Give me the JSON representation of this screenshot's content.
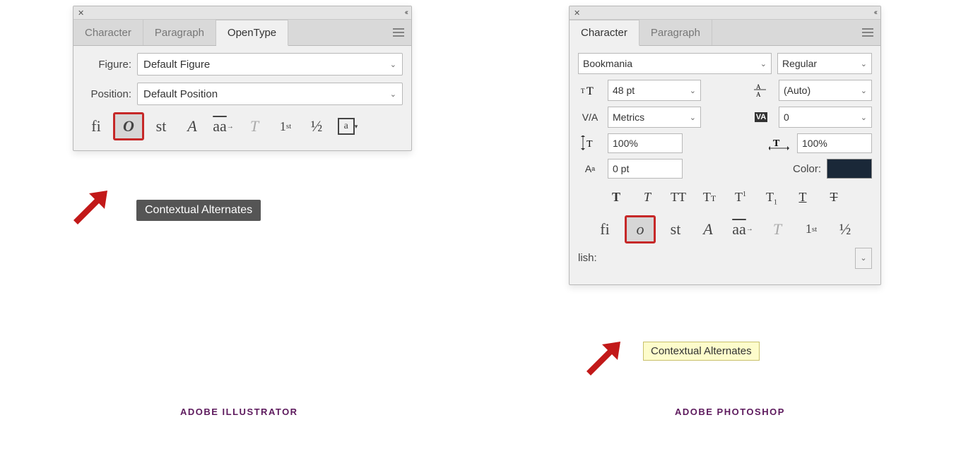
{
  "illustrator": {
    "tabs": [
      "Character",
      "Paragraph",
      "OpenType"
    ],
    "active_tab": "OpenType",
    "figure_label": "Figure:",
    "figure_value": "Default Figure",
    "position_label": "Position:",
    "position_value": "Default Position",
    "tooltip": "Contextual Alternates",
    "caption": "ADOBE ILLUSTRATOR",
    "ot_icons": {
      "ligatures": "fi",
      "contextual": "O",
      "discretionary": "st",
      "swash": "A",
      "stylistic": "aa",
      "titling": "T",
      "ordinals": "1st",
      "fractions": "½",
      "boxed": "a"
    }
  },
  "photoshop": {
    "tabs": [
      "Character",
      "Paragraph"
    ],
    "active_tab": "Character",
    "font_family": "Bookmania",
    "font_style": "Regular",
    "size": "48 pt",
    "leading": "(Auto)",
    "kerning": "Metrics",
    "tracking": "0",
    "vscale": "100%",
    "hscale": "100%",
    "baseline": "0 pt",
    "color_label": "Color:",
    "color": "#1a2838",
    "lang_suffix": "lish:",
    "tooltip": "Contextual Alternates",
    "caption": "ADOBE PHOTOSHOP",
    "style_icons": {
      "bold": "T",
      "italic": "T",
      "allcaps": "TT",
      "smallcaps": "Tᴛ",
      "superscript": "T¹",
      "subscript": "T₁",
      "underline": "T",
      "strike": "T"
    },
    "ot_icons": {
      "ligatures": "fi",
      "contextual": "o",
      "discretionary": "st",
      "swash": "A",
      "stylistic": "aa",
      "titling": "T",
      "ordinals": "1st",
      "fractions": "½"
    }
  }
}
